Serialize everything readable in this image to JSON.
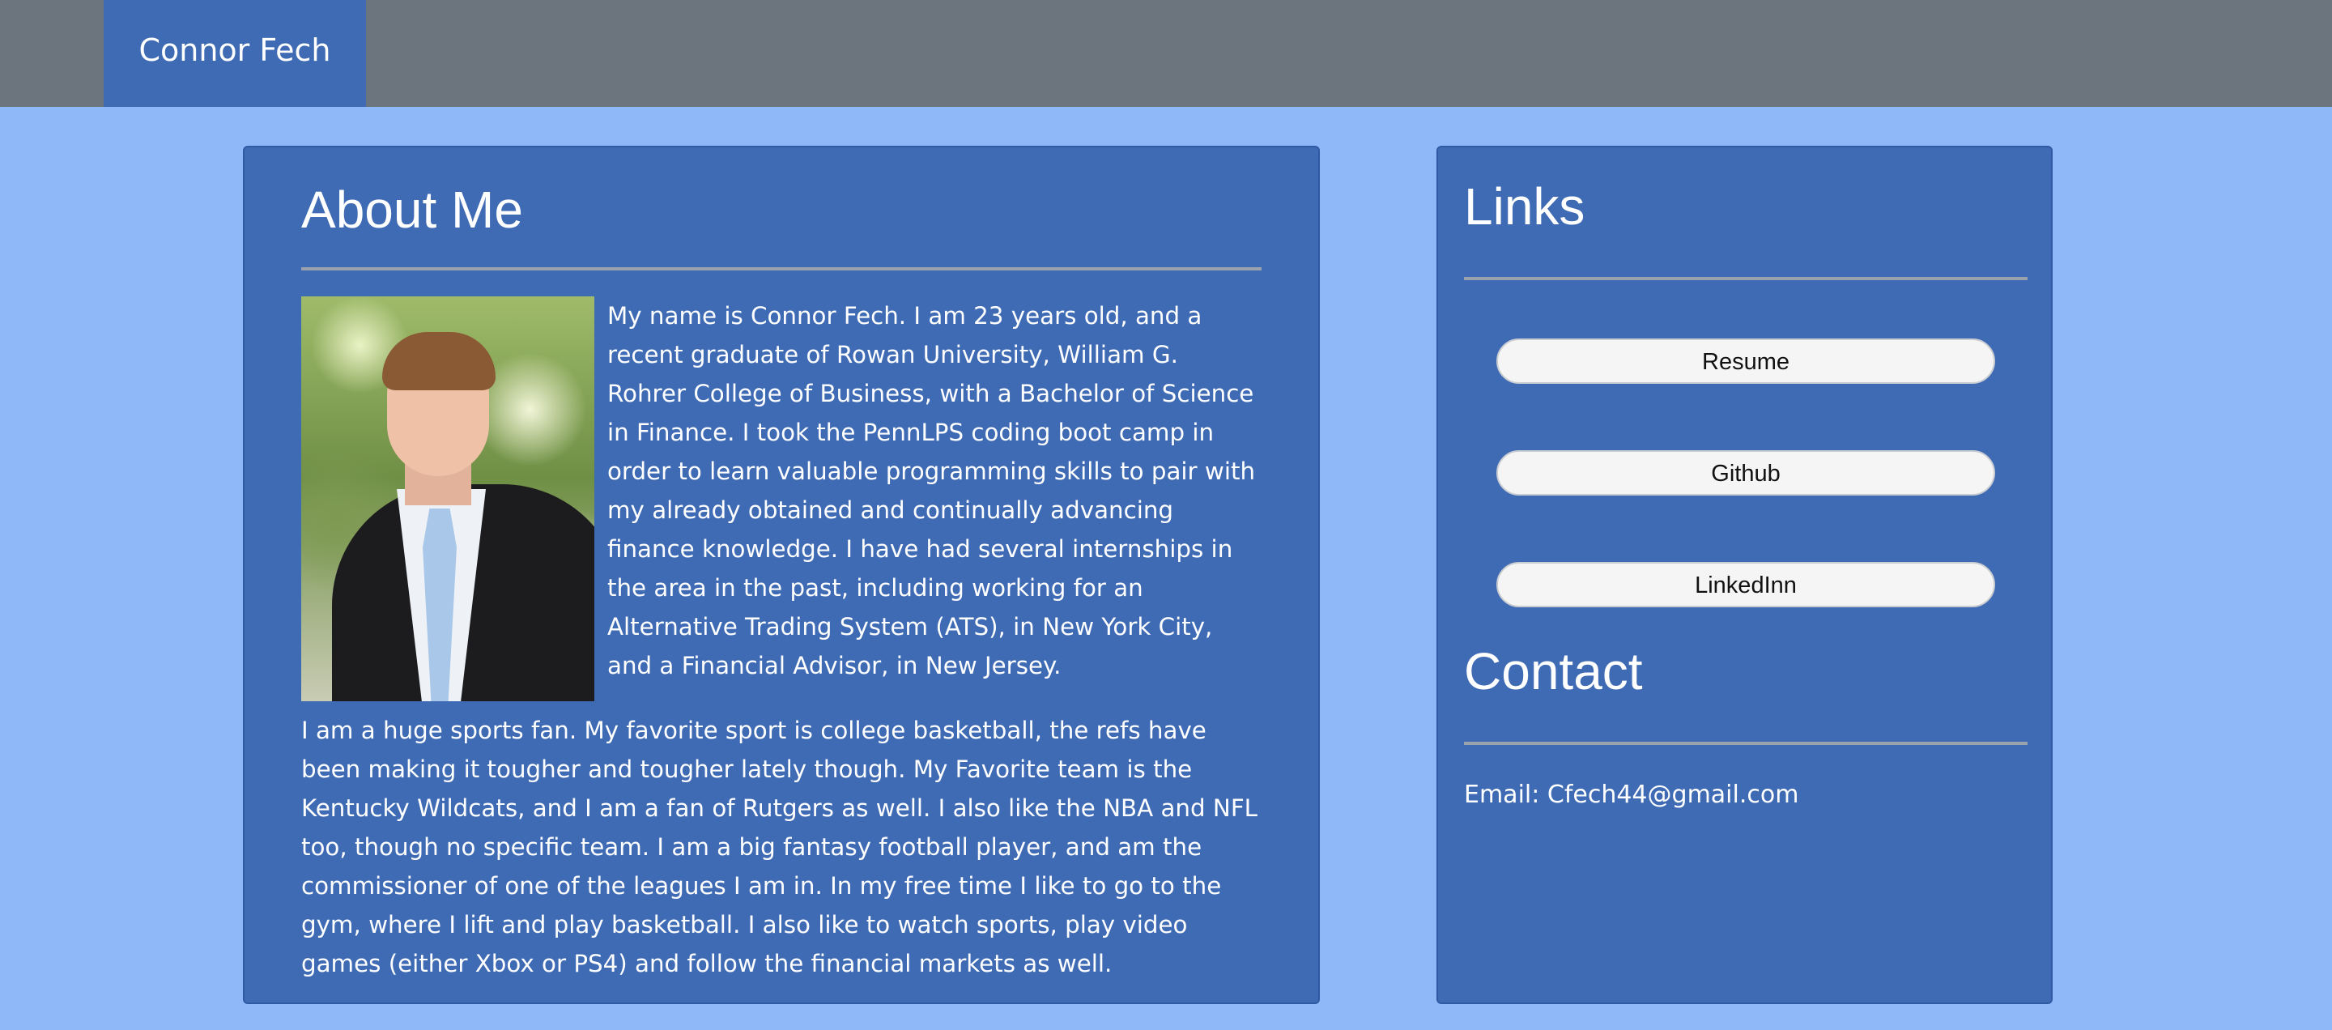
{
  "navbar": {
    "brand": "Connor Fech"
  },
  "about": {
    "title": "About Me",
    "paragraphs": [
      "My name is Connor Fech. I am 23 years old, and a recent graduate of Rowan University, William G. Rohrer College of Business, with a Bachelor of Science in Finance. I took the PennLPS coding boot camp in order to learn valuable programming skills to pair with my already obtained and continually advancing finance knowledge. I have had several internships in the area in the past, including working for an Alternative Trading System (ATS), in New York City, and a Financial Advisor, in New Jersey.",
      "I am a huge sports fan. My favorite sport is college basketball, the refs have been making it tougher and tougher lately though. My Favorite team is the Kentucky Wildcats, and I am a fan of Rutgers as well. I also like the NBA and NFL too, though no specific team. I am a big fantasy football player, and am the commissioner of one of the leagues I am in. In my free time I like to go to the gym, where I lift and play basketball. I also like to watch sports, play video games (either Xbox or PS4) and follow the financial markets as well."
    ]
  },
  "links": {
    "title": "Links",
    "buttons": [
      "Resume",
      "Github",
      "LinkedInn"
    ]
  },
  "contact": {
    "title": "Contact",
    "email": "Email: Cfech44@gmail.com"
  },
  "colors": {
    "page_background": "#8fb8f8",
    "navbar": "#6c757d",
    "card": "#3f6bb5",
    "button": "#f5f5f5"
  }
}
